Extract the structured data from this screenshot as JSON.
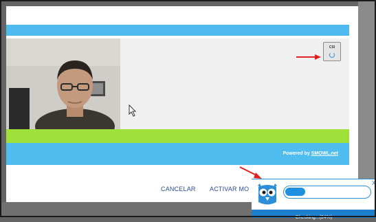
{
  "camera_button": {
    "label": "CSI"
  },
  "footer": {
    "powered_prefix": "Powered by ",
    "powered_link": "SMOWL.net"
  },
  "actions": {
    "cancel_label": "CANCELAR",
    "activate_label": "ACTIVAR MO"
  },
  "smowl_widget": {
    "close_label": "X",
    "progress": 0.24,
    "status": "Checking...(24%)"
  },
  "colors": {
    "accent_blue": "#4dbbef",
    "accent_green": "#9fe03a",
    "widget_blue": "#1e7fcf",
    "annotation_red": "#e02020",
    "button_text": "#2d4a8e"
  },
  "icons": [
    "refresh-icon",
    "cursor-icon",
    "owl-logo-icon",
    "arrow-annotation-icon"
  ]
}
